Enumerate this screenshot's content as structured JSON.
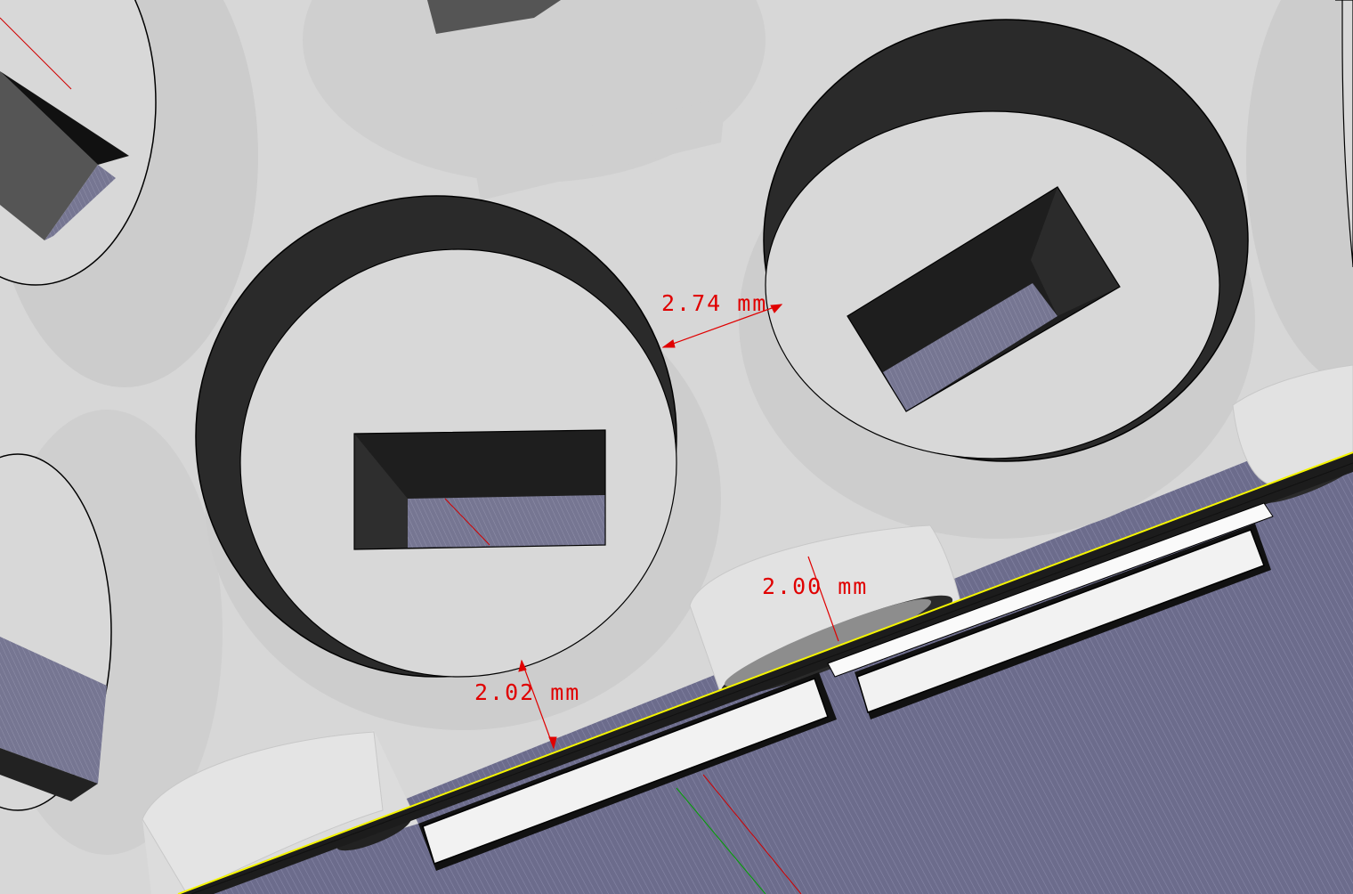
{
  "viewport": {
    "colors": {
      "background": "#d7d7d7",
      "model_face": "#d8d8d8",
      "shadow_face": "#c7c7c7",
      "bore_wall": "#2a2a2a",
      "pocket_floor": "#767692",
      "base_plate": "#6c6c8c",
      "edge_highlight": "#f5f500",
      "dimension": "#e00000",
      "outline": "#000000"
    },
    "measurements": [
      {
        "id": "gap-between-bores",
        "label": "2.74 mm"
      },
      {
        "id": "wall-to-edge-right",
        "label": "2.00 mm"
      },
      {
        "id": "wall-to-edge-left",
        "label": "2.02 mm"
      }
    ]
  }
}
